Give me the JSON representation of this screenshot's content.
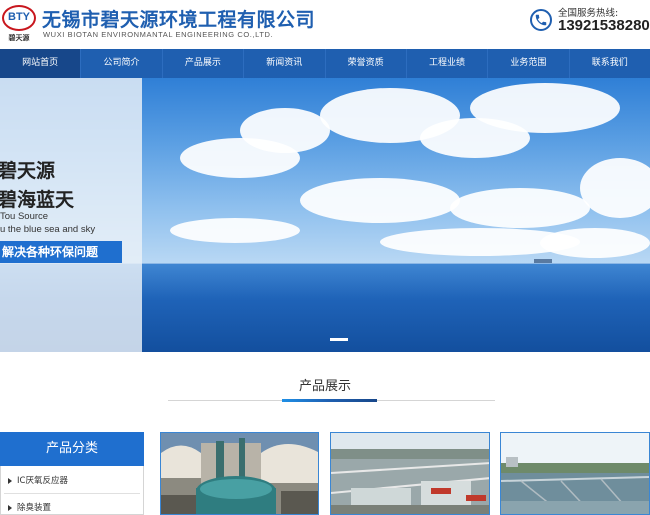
{
  "header": {
    "logo_letters": "BTY",
    "logo_cn": "碧天源",
    "company_name": "无锡市碧天源环境工程有限公司",
    "company_en": "WUXI BIOTAN ENVIRONMANTAL ENGINEERING CO.,LTD.",
    "hotline_label": "全国服务热线:",
    "hotline_number": "13921538280",
    "phone_icon": "phone-icon"
  },
  "nav": {
    "items": [
      {
        "label": "网站首页",
        "active": true
      },
      {
        "label": "公司简介",
        "active": false
      },
      {
        "label": "产品展示",
        "active": false
      },
      {
        "label": "新闻资讯",
        "active": false
      },
      {
        "label": "荣誉资质",
        "active": false
      },
      {
        "label": "工程业绩",
        "active": false
      },
      {
        "label": "业务范围",
        "active": false
      },
      {
        "label": "联系我们",
        "active": false
      }
    ]
  },
  "banner": {
    "line1": "碧天源",
    "line2": "碧海蓝天",
    "en1": "Tou Source",
    "en2": "u the blue sea and sky",
    "bar": "解决各种环保问题"
  },
  "products_section": {
    "title": "产品展示"
  },
  "categories": {
    "title": "产品分类",
    "items": [
      "IC厌氧反应器",
      "除臭装置"
    ]
  },
  "colors": {
    "brand_blue": "#1f5fb0",
    "nav_active": "#17478a",
    "accent": "#1f6fcf",
    "logo_red": "#c8171e"
  }
}
